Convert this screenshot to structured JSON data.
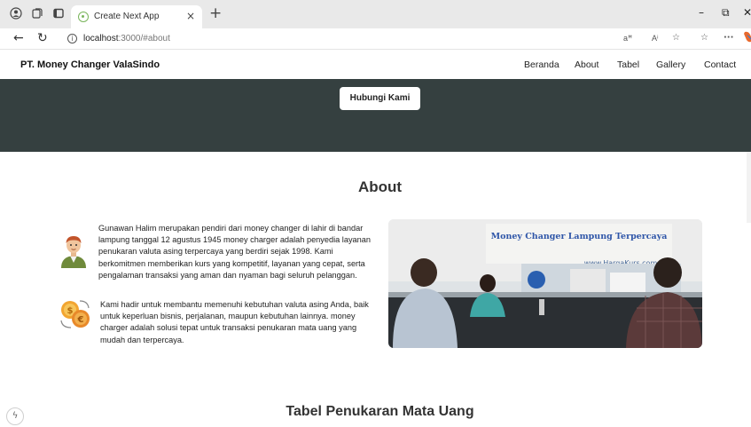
{
  "browser": {
    "tab_title": "Create Next App",
    "tab_close": "×",
    "new_tab": "+",
    "url_host": "localhost",
    "url_path": ":3000/#about",
    "reader_mode": "aꟸ",
    "read_aloud": "Aⁱ",
    "controls": {
      "minimize": "–",
      "restore": "⧉",
      "close": "✕"
    },
    "more_menu": "···"
  },
  "site": {
    "brand": "PT. Money Changer ValaSindo",
    "nav": [
      "Beranda",
      "About",
      "Tabel",
      "Gallery",
      "Contact"
    ]
  },
  "hero": {
    "button_label": "Hubungi Kami",
    "bg_color": "#354040"
  },
  "about": {
    "title": "About",
    "paragraph1": "Gunawan Halim merupakan pendiri dari money changer di lahir di bandar lampung tanggal 12 agustus 1945 money charger adalah penyedia layanan penukaran valuta asing terpercaya yang berdiri sejak 1998. Kami berkomitmen memberikan kurs yang kompetitif, layanan yang cepat, serta pengalaman transaksi yang aman dan nyaman bagi seluruh pelanggan.",
    "paragraph2": "Kami hadir untuk membantu memenuhi kebutuhan valuta asing Anda, baik untuk keperluan bisnis, perjalanan, maupun kebutuhan lainnya. money charger adalah solusi tepat untuk transaksi penukaran mata uang yang mudah dan terpercaya.",
    "photo_sign": "Money Changer Lampung Terpercaya",
    "photo_url": "www.HargaKurs.com"
  },
  "table_section": {
    "title": "Tabel Penukaran Mata Uang"
  },
  "icons": [
    "profile-icon",
    "collections-icon",
    "tab-actions-icon",
    "back-icon",
    "refresh-icon",
    "info-icon",
    "favorites-icon",
    "favorites-bar-icon",
    "avatar-icon",
    "money-exchange-icon",
    "copilot-icon"
  ]
}
